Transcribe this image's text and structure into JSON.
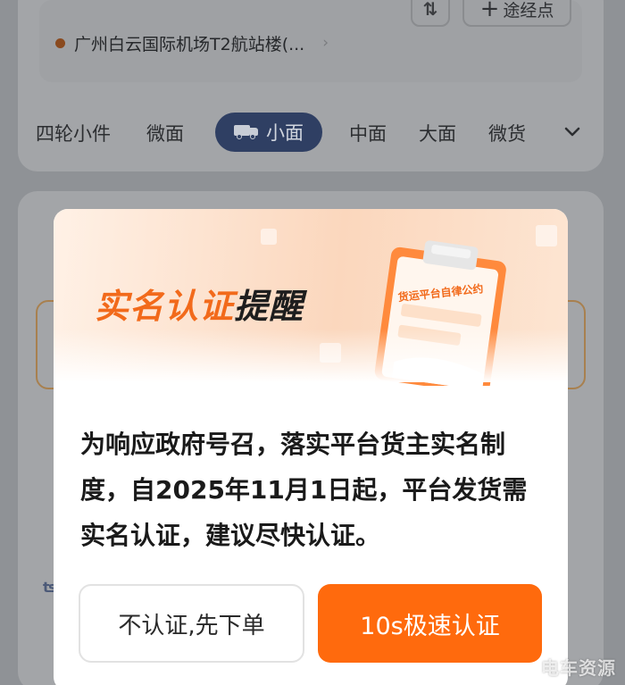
{
  "route": {
    "waypoint_label": "途经点",
    "destination": "广州白云国际机场T2航站楼(...",
    "dest_arrow": "›"
  },
  "vehicle_tabs": {
    "items": [
      "四轮小件",
      "微面",
      "小面",
      "中面",
      "大面",
      "微货"
    ],
    "selected_index": 2,
    "selected_label": "小面"
  },
  "dialog": {
    "title_highlight": "实名认证",
    "title_rest": "提醒",
    "illustration_text": "货运平台自律公约",
    "message": "为响应政府号召，落实平台货主实名制度，自2025年11月1日起，平台发货需实名认证，建议尽快认证。",
    "skip_label": "不认证,先下单",
    "verify_label": "10s极速认证"
  },
  "watermark": "电车资源",
  "colors": {
    "accent": "#ff6a0d",
    "selected_tab": "#2f3f63",
    "overlay": "#8f9296"
  }
}
